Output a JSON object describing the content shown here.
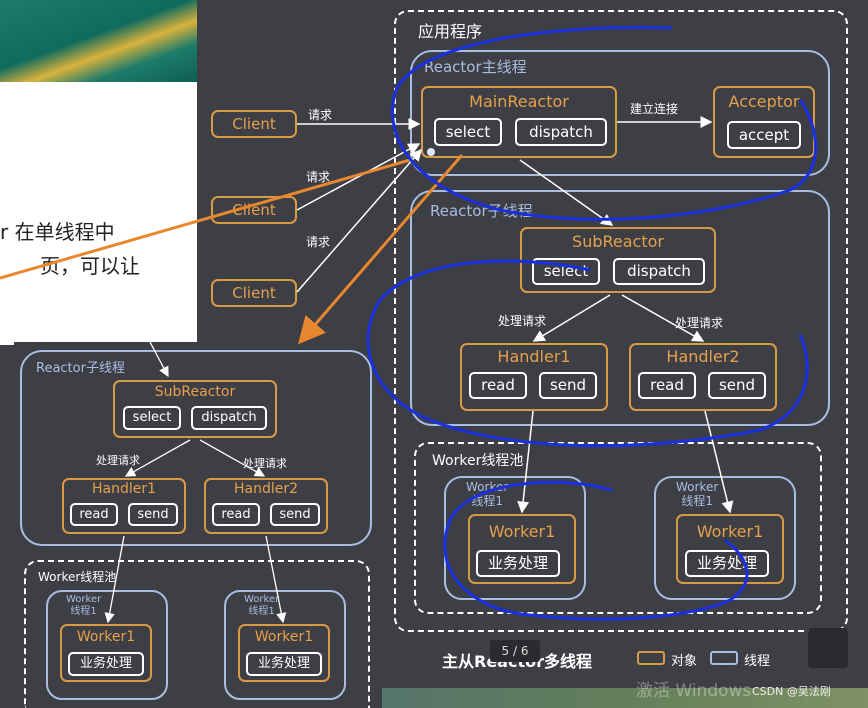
{
  "main": {
    "app_title": "应用程序",
    "reactor_main_thread": "Reactor主线程",
    "reactor_sub_thread": "Reactor子线程",
    "worker_pool": "Worker线程池",
    "main_reactor": {
      "title": "MainReactor",
      "select": "select",
      "dispatch": "dispatch"
    },
    "acceptor": {
      "title": "Acceptor",
      "accept": "accept"
    },
    "connect_label": "建立连接",
    "sub_reactor": {
      "title": "SubReactor",
      "select": "select",
      "dispatch": "dispatch"
    },
    "process_label_1": "处理请求",
    "process_label_2": "处理请求",
    "handler1": {
      "title": "Handler1",
      "read": "read",
      "send": "send"
    },
    "handler2": {
      "title": "Handler2",
      "read": "read",
      "send": "send"
    },
    "worker_thread_1": "Worker\n线程1",
    "worker_thread_2": "Worker\n线程1",
    "worker1": {
      "title": "Worker1",
      "biz": "业务处理"
    },
    "worker2": {
      "title": "Worker1",
      "biz": "业务处理"
    }
  },
  "clients": {
    "c1": "Client",
    "c2": "Client",
    "c3": "Client",
    "req1": "请求",
    "req2": "请求",
    "req3": "请求"
  },
  "slide_text": {
    "line1": "r 在单线程中",
    "line2": "页，可以让"
  },
  "zoom": {
    "reactor_sub_thread": "Reactor子线程",
    "worker_pool": "Worker线程池",
    "sub_reactor": {
      "title": "SubReactor",
      "select": "select",
      "dispatch": "dispatch"
    },
    "process_label_1": "处理请求",
    "process_label_2": "处理请求",
    "handler1": {
      "title": "Handler1",
      "read": "read",
      "send": "send"
    },
    "handler2": {
      "title": "Handler2",
      "read": "read",
      "send": "send"
    },
    "worker_thread_1": "Worker\n线程1",
    "worker_thread_2": "Worker\n线程1",
    "worker1": {
      "title": "Worker1",
      "biz": "业务处理"
    },
    "worker2": {
      "title": "Worker1",
      "biz": "业务处理"
    }
  },
  "footer": {
    "title": "主从Reactor多线程",
    "page_indicator": "5 / 6",
    "legend_object": "对象",
    "legend_thread": "线程",
    "watermark_csdn": "CSDN @吴法刚",
    "watermark_windows": "激活 Windows"
  },
  "colors": {
    "background": "#3d3f44",
    "object_border": "#d99a45",
    "thread_border": "#a9bde3",
    "annotation_blue": "#1a2fe0",
    "arrow_orange": "#e8872e"
  }
}
